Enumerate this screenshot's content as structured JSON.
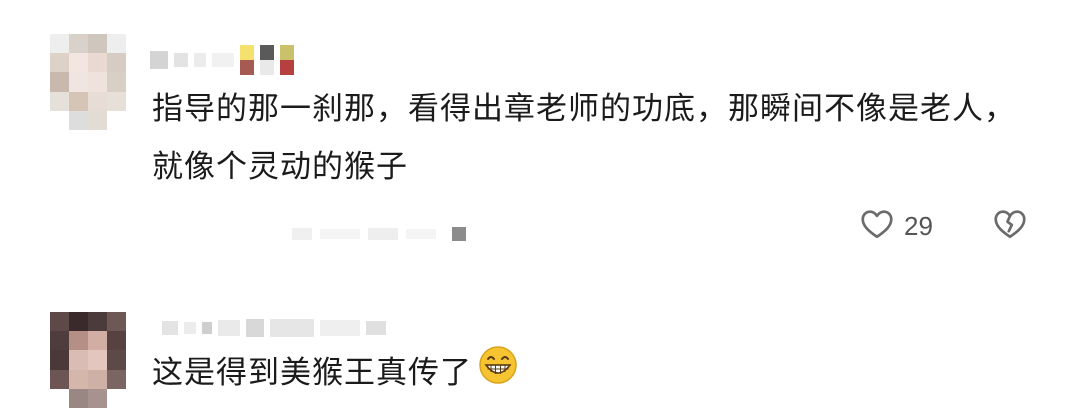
{
  "comments": [
    {
      "username_hidden": true,
      "text": "指导的那一刹那，看得出章老师的功底，那瞬间不像是老人，就像个灵动的猴子",
      "like_count": "29",
      "icons": {
        "like": "heart-outline-icon",
        "dislike": "broken-heart-icon"
      }
    },
    {
      "username_hidden": true,
      "text": "这是得到美猴王真传了",
      "emoji": "grinning-face-icon"
    }
  ],
  "colors": {
    "text": "#1b1b1b",
    "icon": "#6b6b6b",
    "emoji_yellow": "#f6c431"
  }
}
